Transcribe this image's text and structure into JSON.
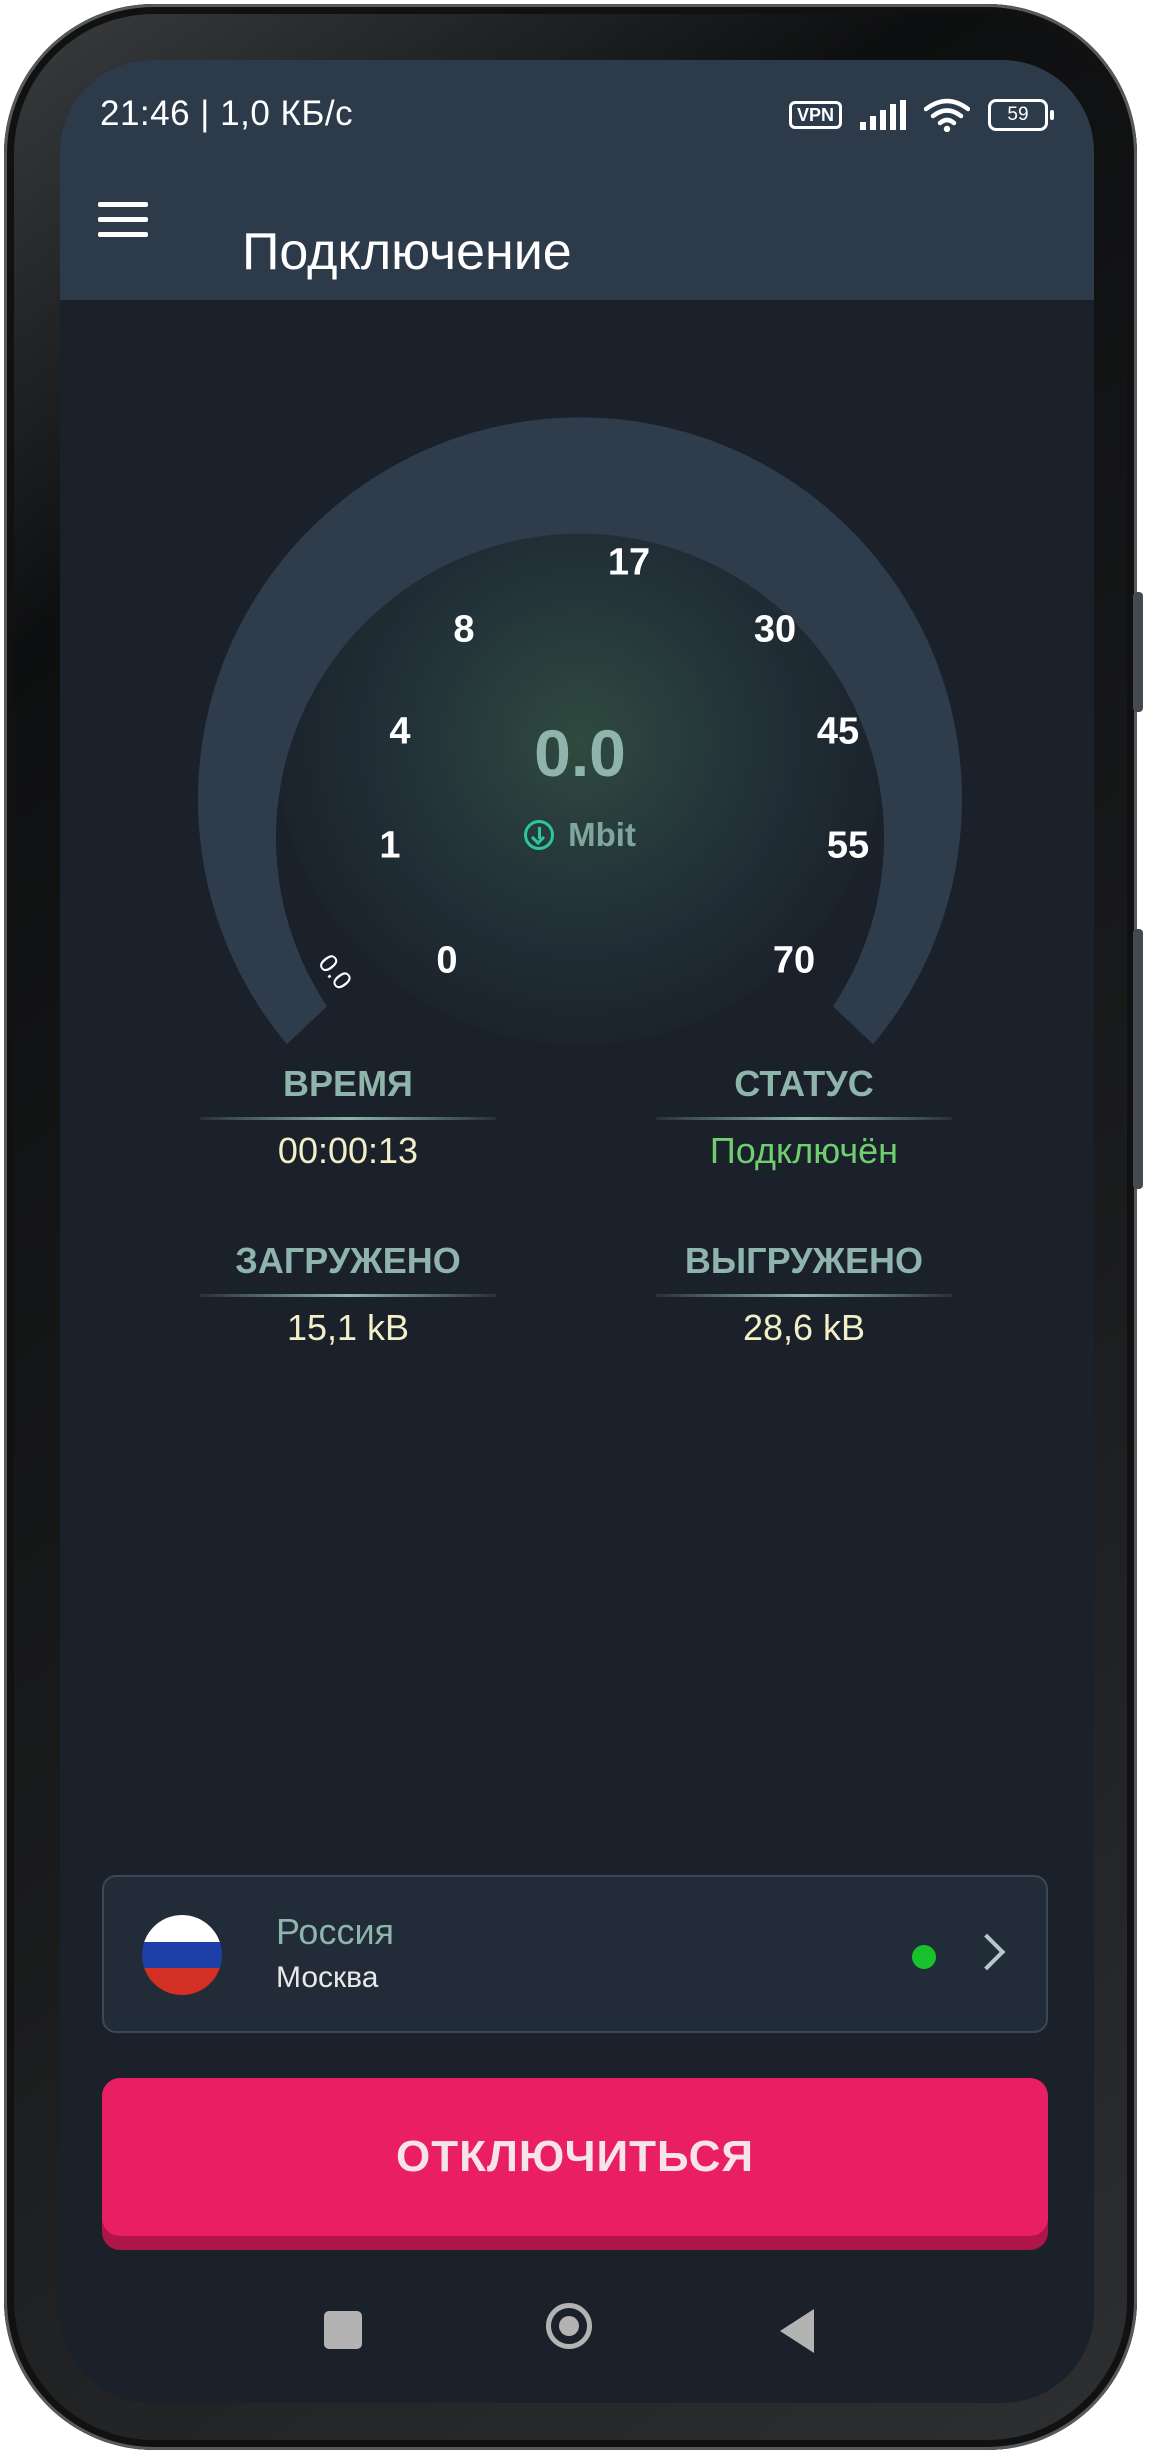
{
  "status_bar": {
    "time_speed": "21:46 | 1,0 КБ/с",
    "vpn_label": "VPN",
    "battery": "59"
  },
  "app_bar": {
    "title": "Подключение"
  },
  "gauge": {
    "speed_value": "0.0",
    "speed_unit": "Mbit",
    "needle_value": "0.0",
    "ticks": [
      "0",
      "1",
      "4",
      "8",
      "17",
      "30",
      "45",
      "55",
      "70"
    ]
  },
  "stats": {
    "time_label": "ВРЕМЯ",
    "time_value": "00:00:13",
    "status_label": "СТАТУС",
    "status_value": "Подключён",
    "downloaded_label": "ЗАГРУЖЕНО",
    "downloaded_value": "15,1 kB",
    "uploaded_label": "ВЫГРУЖЕНО",
    "uploaded_value": "28,6 kB"
  },
  "server": {
    "country": "Россия",
    "city": "Москва",
    "online": true,
    "flag_icon": "russia-flag-icon"
  },
  "actions": {
    "disconnect_label": "ОТКЛЮЧИТЬСЯ"
  },
  "colors": {
    "background": "#1a212a",
    "app_bar": "#2d3a4a",
    "accent_teal": "#8fb4ab",
    "status_ok": "#6fcf6f",
    "value_text": "#f3f0c8",
    "disconnect": "#e91e63",
    "online_dot": "#17c22c"
  }
}
